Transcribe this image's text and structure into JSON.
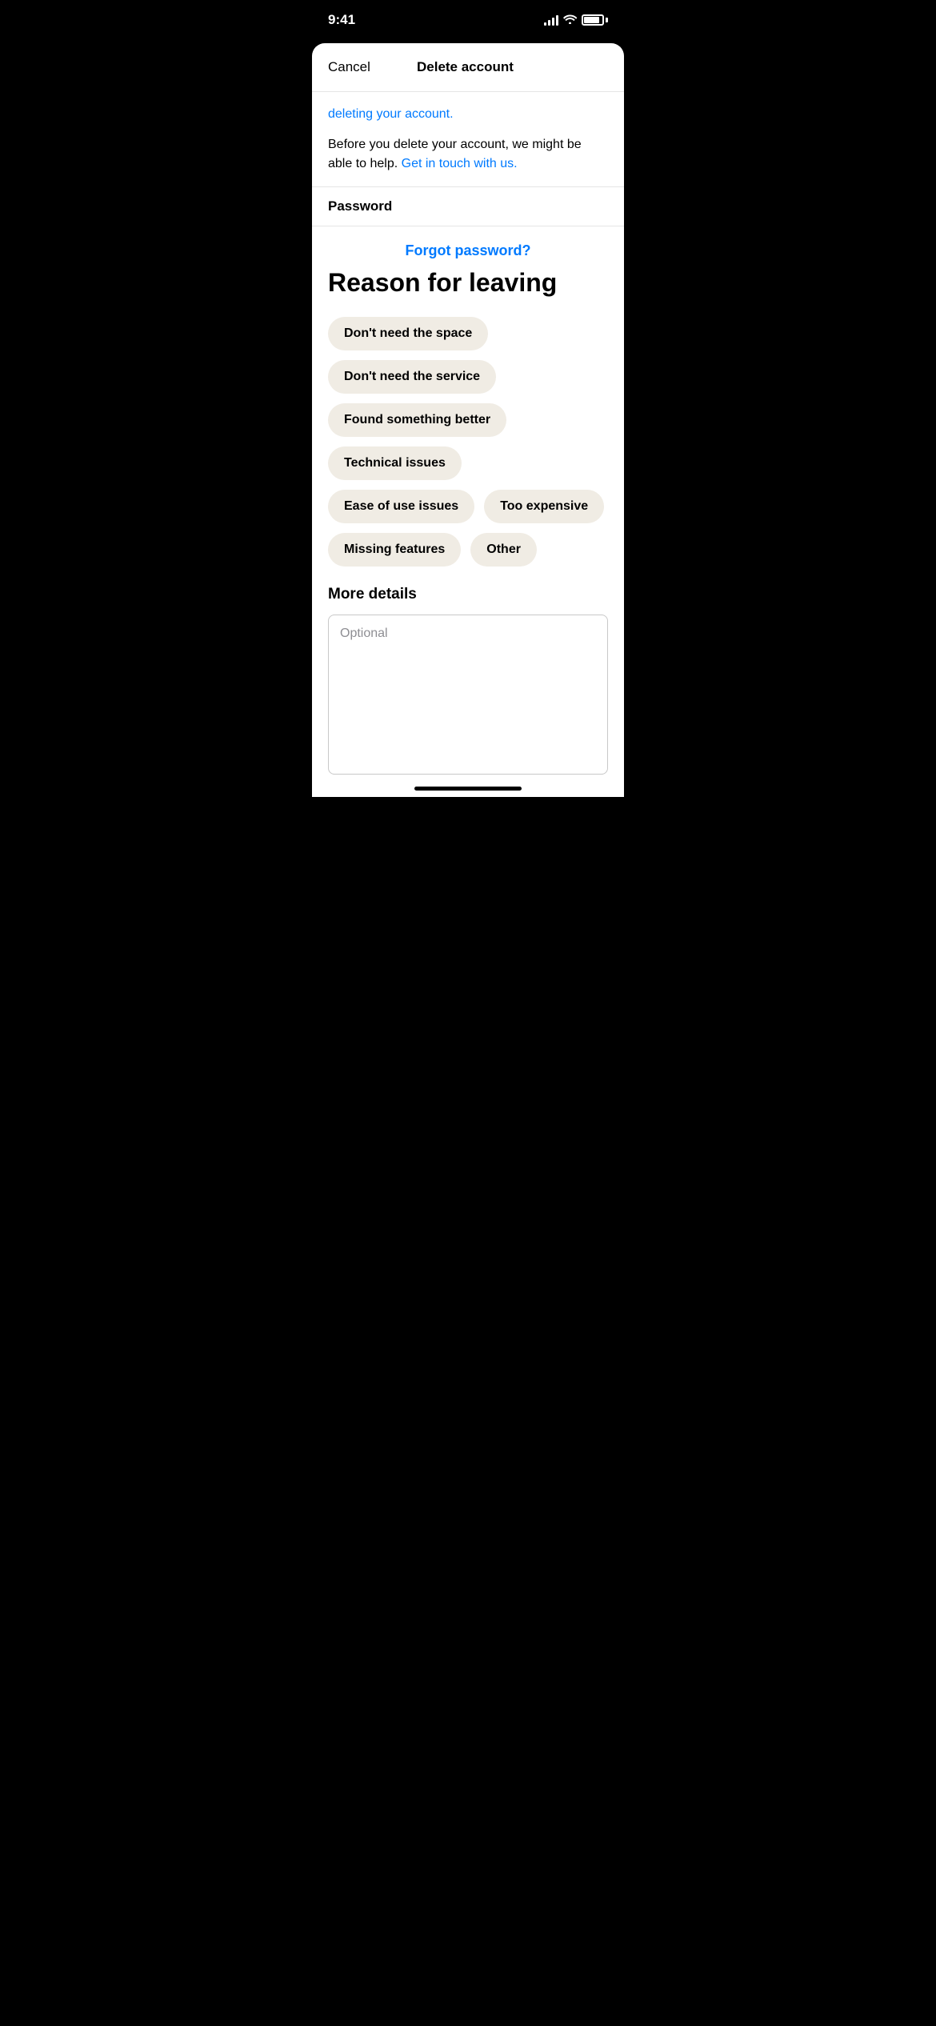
{
  "statusBar": {
    "time": "9:41",
    "signalBars": [
      4,
      7,
      10,
      13
    ],
    "batteryLevel": 85
  },
  "header": {
    "cancelLabel": "Cancel",
    "title": "Delete account"
  },
  "body": {
    "linkText": "deleting your account.",
    "infoText": "Before you delete your account, we might be able to help.",
    "infoLinkText": "Get in touch with us.",
    "passwordLabel": "Password",
    "forgotPasswordLabel": "Forgot password?",
    "reasonTitle": "Reason for leaving",
    "tags": [
      {
        "id": "no-space",
        "label": "Don't need the space"
      },
      {
        "id": "no-service",
        "label": "Don't need the service"
      },
      {
        "id": "found-better",
        "label": "Found something better"
      },
      {
        "id": "technical",
        "label": "Technical issues"
      },
      {
        "id": "ease-of-use",
        "label": "Ease of use issues"
      },
      {
        "id": "too-expensive",
        "label": "Too expensive"
      },
      {
        "id": "missing-features",
        "label": "Missing features"
      },
      {
        "id": "other",
        "label": "Other"
      }
    ],
    "moreDetailsLabel": "More details",
    "detailsPlaceholder": "Optional"
  }
}
